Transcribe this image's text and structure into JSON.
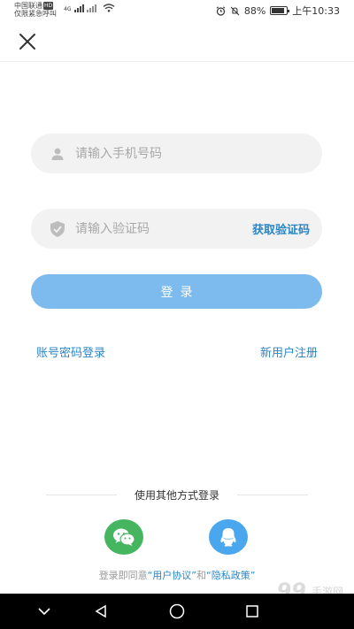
{
  "status_bar": {
    "carrier_line1": "中国联通",
    "hd_badge": "HD",
    "carrier_line2": "仅限紧急呼叫",
    "network_label": "4G",
    "battery_percent": "88%",
    "battery_level": 0.88,
    "time": "上午10:33"
  },
  "topbar": {
    "close_icon": "close-icon"
  },
  "login_form": {
    "phone_placeholder": "请输入手机号码",
    "phone_value": "",
    "code_placeholder": "请输入验证码",
    "code_value": "",
    "get_code_label": "获取验证码",
    "login_label": "登录"
  },
  "links": {
    "account_login": "账号密码登录",
    "register": "新用户注册"
  },
  "other_login": {
    "title": "使用其他方式登录",
    "methods": [
      {
        "icon": "wechat-icon",
        "color": "#45b65f"
      },
      {
        "icon": "qq-icon",
        "color": "#4aa7ee"
      }
    ]
  },
  "agreement": {
    "prefix": "登录即同意",
    "user_agreement": "“用户协议”",
    "and": "和",
    "privacy_policy": "“隐私政策”"
  },
  "watermark": {
    "number": "99",
    "text": "手游网"
  },
  "colors": {
    "accent": "#2b86c5",
    "login_button": "#7dbbee",
    "input_bg": "#f2f2f2",
    "wechat": "#45b65f",
    "qq": "#4aa7ee",
    "navbar": "#000000"
  }
}
